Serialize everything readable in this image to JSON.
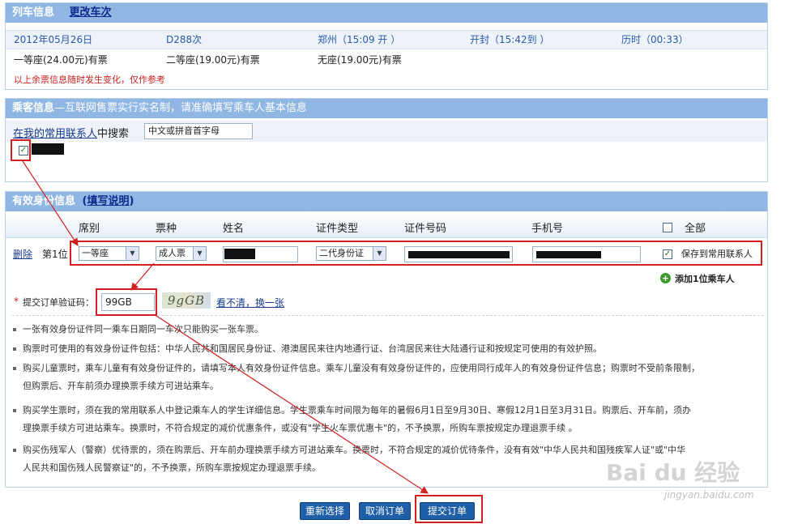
{
  "train": {
    "title": "列车信息",
    "change_link": "更改车次",
    "date": "2012年05月26日",
    "train_no": "D288次",
    "from": "郑州（15:09 开 ）",
    "to": "开封（15:42到 ）",
    "duration": "历时（00:33）",
    "seat1": "一等座(24.00元)有票",
    "seat2": "二等座(19.00元)有票",
    "seat3": "无座(19.00元)有票",
    "warning": "以上余票信息随时发生变化，仅作参考"
  },
  "passenger": {
    "title": "乘客信息",
    "subtitle": "—互联网售票实行实名制，请准确填写乘车人基本信息",
    "search_prefix": "在我的常用联系人",
    "search_suffix": "中搜索",
    "search_placeholder": "中文或拼音首字母"
  },
  "id_info": {
    "title": "有效身份信息",
    "help_open": "(",
    "help_link": "填写说明",
    "help_close": ")",
    "headers": {
      "seat": "席别",
      "ticket": "票种",
      "name": "姓名",
      "id_type": "证件类型",
      "id_no": "证件号码",
      "phone": "手机号",
      "all": "全部"
    },
    "row": {
      "delete": "删除",
      "index": "第1位",
      "seat": "一等座",
      "ticket": "成人票",
      "id_type": "二代身份证",
      "save_contact": "保存到常用联系人"
    },
    "add_passenger": "添加1位乘车人",
    "captcha_star": "*",
    "captcha_label": "提交订单验证码：",
    "captcha_value": "99GB",
    "captcha_image_text": "9gGB",
    "captcha_refresh": "看不清，换一张"
  },
  "notes": [
    "一张有效身份证件同一乘车日期同一车次只能购买一张车票。",
    "购票时可使用的有效身份证件包括：中华人民共和国居民身份证、港澳居民来往内地通行证、台湾居民来往大陆通行证和按规定可使用的有效护照。",
    "购买儿童票时，乘车儿童有有效身份证件的，请填写本人有效身份证件信息。乘车儿童没有有效身份证件的，应使用同行成年人的有效身份证件信息；购票时不受前条限制，",
    "但购票后、开车前须办理换票手续方可进站乘车。",
    "购买学生票时，须在我的常用联系人中登记乘车人的学生详细信息。学生票乘车时间限为每年的暑假6月1日至9月30日、寒假12月1日至3月31日。购票后、开车前，须办",
    "理换票手续方可进站乘车。换票时，不符合规定的减价优惠条件，或没有\"学生火车票优惠卡\"的，不予换票，所购车票按规定办理退票手续 。",
    "购买伤残军人（警察）优待票的，须在购票后、开车前办理换票手续方可进站乘车。换票时，不符合规定的减价优待条件，没有有效\"中华人民共和国残疾军人证\"或\"中华",
    "人民共和国伤残人民警察证\"的，不予换票，所购车票按规定办理退票手续。"
  ],
  "buttons": {
    "reselect": "重新选择",
    "cancel": "取消订单",
    "submit": "提交订单"
  },
  "watermark": {
    "brand": "Bai du 经验",
    "url": "jingyan.baidu.com"
  }
}
